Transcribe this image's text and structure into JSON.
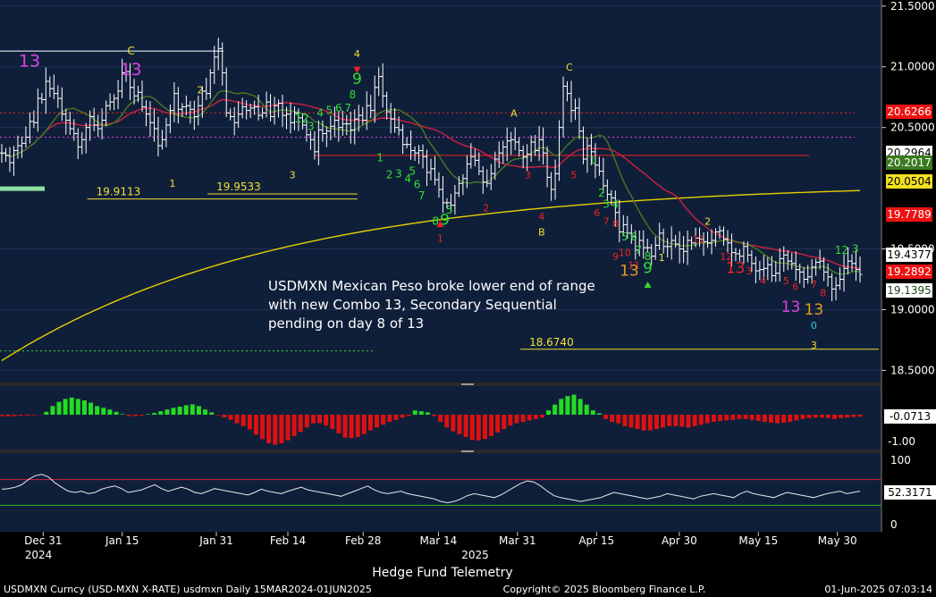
{
  "chart_data": {
    "type": "ohlc-bar",
    "instrument": "USDMXN",
    "colors": {
      "panel_bg": "#0f1f3a",
      "gap_bg": "#2a2a2a",
      "frame": "#7a7a7a",
      "bars": "#ffffff",
      "ma_yellow": "#e6d000",
      "ma_red": "#d02040",
      "ma_green": "#4a7a20",
      "td_green": "#33dd33",
      "td_yellow": "#f0e030",
      "td_red": "#ee2222",
      "td_magenta": "#e040e0",
      "td_orange": "#e89a1a",
      "hist_pos": "#22dd22",
      "hist_neg": "#dd1111",
      "rsi_line": "#e8e8e8"
    },
    "price_axis": {
      "min": 18.4,
      "max": 21.55,
      "ticks": [
        "21.5000",
        "21.0000",
        "20.5000",
        "19.5000",
        "19.0000",
        "18.5000"
      ],
      "tick_values": [
        21.5,
        21.0,
        20.5,
        19.5,
        19.0,
        18.5
      ]
    },
    "price_badges": [
      {
        "label": "20.6266",
        "value": 20.6266,
        "bg": "#ee1111",
        "fg": "#ffffff"
      },
      {
        "label": "20.2964",
        "value": 20.2964,
        "bg": "#ffffff",
        "fg": "#000000"
      },
      {
        "label": "20.2017",
        "value": 20.2017,
        "bg": "#3a7a20",
        "fg": "#ffffff"
      },
      {
        "label": "20.0504",
        "value": 20.0504,
        "bg": "#f0e020",
        "fg": "#000000"
      },
      {
        "label": "19.7789",
        "value": 19.7789,
        "bg": "#ee1111",
        "fg": "#ffffff"
      },
      {
        "label": "19.4377",
        "value": 19.4377,
        "bg": "#ffffff",
        "fg": "#000000"
      },
      {
        "label": "19.2892",
        "value": 19.2892,
        "bg": "#ee1111",
        "fg": "#ffffff"
      },
      {
        "label": "19.1395",
        "value": 19.1395,
        "bg": "#ffffff",
        "fg": "#1a4a1a"
      }
    ],
    "levels": [
      {
        "label": "19.9113",
        "value": 19.9113,
        "from": 28,
        "to": 82,
        "color": "#f0e030"
      },
      {
        "label": "19.9533",
        "value": 19.9533,
        "from": 58,
        "to": 82,
        "color": "#f0e030"
      },
      {
        "label": "18.6740",
        "value": 18.674,
        "from": 136,
        "to": 212,
        "color": "#f0e030"
      }
    ],
    "x_axis": {
      "labels": [
        {
          "text": "Dec 31",
          "i": 11
        },
        {
          "text": "Jan 15",
          "i": 32
        },
        {
          "text": "Jan 31",
          "i": 57
        },
        {
          "text": "Feb 14",
          "i": 76
        },
        {
          "text": "Feb 28",
          "i": 96
        },
        {
          "text": "Mar 14",
          "i": 116
        },
        {
          "text": "Mar 31",
          "i": 137
        },
        {
          "text": "Apr 15",
          "i": 158
        },
        {
          "text": "Apr 30",
          "i": 180
        },
        {
          "text": "May 15",
          "i": 201
        },
        {
          "text": "May 30",
          "i": 222
        }
      ],
      "years": [
        {
          "text": "2024",
          "i": 5
        },
        {
          "text": "2025",
          "i": 121
        }
      ]
    },
    "series": [
      {
        "name": "USDMXN",
        "close": [
          20.29,
          20.27,
          20.21,
          20.31,
          20.35,
          20.37,
          20.42,
          20.55,
          20.54,
          20.74,
          20.73,
          20.88,
          20.82,
          20.78,
          20.74,
          20.61,
          20.56,
          20.49,
          20.45,
          20.34,
          20.4,
          20.5,
          20.59,
          20.52,
          20.49,
          20.56,
          20.68,
          20.71,
          20.74,
          20.8,
          20.95,
          20.96,
          20.83,
          20.76,
          20.79,
          20.67,
          20.61,
          20.54,
          20.49,
          20.35,
          20.4,
          20.52,
          20.64,
          20.78,
          20.65,
          20.67,
          20.68,
          20.65,
          20.59,
          20.68,
          20.8,
          20.78,
          20.95,
          21.08,
          21.15,
          20.95,
          20.62,
          20.59,
          20.54,
          20.61,
          20.67,
          20.64,
          20.66,
          20.67,
          20.6,
          20.62,
          20.71,
          20.59,
          20.68,
          20.7,
          20.6,
          20.61,
          20.54,
          20.62,
          20.58,
          20.52,
          20.44,
          20.4,
          20.3,
          20.48,
          20.45,
          20.47,
          20.51,
          20.56,
          20.5,
          20.53,
          20.53,
          20.48,
          20.57,
          20.6,
          20.56,
          20.68,
          20.64,
          20.83,
          20.92,
          20.76,
          20.63,
          20.57,
          20.5,
          20.48,
          20.36,
          20.36,
          20.31,
          20.29,
          20.31,
          20.26,
          20.13,
          20.16,
          20.07,
          19.99,
          19.88,
          19.88,
          19.86,
          19.96,
          20.04,
          20.08,
          20.2,
          20.26,
          20.23,
          20.14,
          20.05,
          20.04,
          20.12,
          20.24,
          20.29,
          20.34,
          20.39,
          20.4,
          20.38,
          20.31,
          20.26,
          20.28,
          20.38,
          20.31,
          20.4,
          20.29,
          20.09,
          19.99,
          20.12,
          20.5,
          20.84,
          20.78,
          20.64,
          20.66,
          20.47,
          20.24,
          20.35,
          20.3,
          20.19,
          20.14,
          20.02,
          19.95,
          19.92,
          19.8,
          19.64,
          19.7,
          19.63,
          19.6,
          19.49,
          19.57,
          19.51,
          19.51,
          19.44,
          19.53,
          19.63,
          19.52,
          19.52,
          19.57,
          19.54,
          19.5,
          19.48,
          19.57,
          19.55,
          19.59,
          19.58,
          19.56,
          19.55,
          19.57,
          19.64,
          19.65,
          19.58,
          19.55,
          19.47,
          19.46,
          19.44,
          19.52,
          19.45,
          19.38,
          19.32,
          19.33,
          19.34,
          19.37,
          19.28,
          19.3,
          19.42,
          19.45,
          19.4,
          19.38,
          19.33,
          19.31,
          19.25,
          19.27,
          19.35,
          19.39,
          19.4,
          19.31,
          19.27,
          19.17,
          19.2,
          19.25,
          19.34,
          19.4,
          19.38,
          19.33,
          19.29
        ]
      },
      {
        "name": "MA-yellow-long"
      },
      {
        "name": "MA-red"
      },
      {
        "name": "MA-green"
      }
    ],
    "td_labels": [
      {
        "t": "13",
        "i": 6,
        "v": 21.0,
        "c": "td_magenta",
        "s": 19
      },
      {
        "t": "C",
        "i": 28,
        "v": 21.1,
        "c": "td_yellow",
        "s": 12
      },
      {
        "t": "13",
        "i": 28,
        "v": 20.93,
        "c": "td_magenta",
        "s": 19
      },
      {
        "t": "1",
        "i": 37,
        "v": 20.01,
        "c": "td_yellow",
        "s": 11
      },
      {
        "t": "2",
        "i": 43,
        "v": 20.78,
        "c": "td_yellow",
        "s": 11
      },
      {
        "t": "12",
        "i": 65,
        "v": 20.54,
        "c": "td_green",
        "s": 13
      },
      {
        "t": "3",
        "i": 67,
        "v": 20.48,
        "c": "td_green",
        "s": 12
      },
      {
        "t": "4",
        "i": 69,
        "v": 20.59,
        "c": "td_green",
        "s": 12
      },
      {
        "t": "5",
        "i": 71,
        "v": 20.61,
        "c": "td_green",
        "s": 12
      },
      {
        "t": "6",
        "i": 73,
        "v": 20.63,
        "c": "td_green",
        "s": 12
      },
      {
        "t": "7",
        "i": 75,
        "v": 20.63,
        "c": "td_green",
        "s": 12
      },
      {
        "t": "8",
        "i": 76,
        "v": 20.74,
        "c": "td_green",
        "s": 12
      },
      {
        "t": "9",
        "i": 77,
        "v": 20.86,
        "c": "td_green",
        "s": 17
      },
      {
        "t": "4",
        "i": 77,
        "v": 21.08,
        "c": "td_yellow",
        "s": 11
      },
      {
        "t": "3",
        "i": 63,
        "v": 20.08,
        "c": "td_yellow",
        "s": 11
      },
      {
        "t": "1",
        "i": 82,
        "v": 20.22,
        "c": "td_green",
        "s": 12
      },
      {
        "t": "2",
        "i": 84,
        "v": 20.08,
        "c": "td_green",
        "s": 12
      },
      {
        "t": "3",
        "i": 86,
        "v": 20.09,
        "c": "td_green",
        "s": 12
      },
      {
        "t": "4",
        "i": 88,
        "v": 20.05,
        "c": "td_green",
        "s": 12
      },
      {
        "t": "5",
        "i": 89,
        "v": 20.11,
        "c": "td_green",
        "s": 12
      },
      {
        "t": "6",
        "i": 90,
        "v": 20.0,
        "c": "td_green",
        "s": 12
      },
      {
        "t": "7",
        "i": 91,
        "v": 19.91,
        "c": "td_green",
        "s": 12
      },
      {
        "t": "5",
        "i": 97,
        "v": 19.79,
        "c": "td_green",
        "s": 12
      },
      {
        "t": "8",
        "i": 94,
        "v": 19.7,
        "c": "td_green",
        "s": 12
      },
      {
        "t": "9",
        "i": 96,
        "v": 19.7,
        "c": "td_green",
        "s": 17
      },
      {
        "t": "1",
        "i": 95,
        "v": 19.56,
        "c": "td_red",
        "s": 11
      },
      {
        "t": "2",
        "i": 105,
        "v": 19.81,
        "c": "td_red",
        "s": 11
      },
      {
        "t": "A",
        "i": 111,
        "v": 20.59,
        "c": "td_yellow",
        "s": 11
      },
      {
        "t": "3",
        "i": 114,
        "v": 20.08,
        "c": "td_red",
        "s": 11
      },
      {
        "t": "4",
        "i": 117,
        "v": 19.74,
        "c": "td_red",
        "s": 11
      },
      {
        "t": "B",
        "i": 117,
        "v": 19.61,
        "c": "td_yellow",
        "s": 11
      },
      {
        "t": "5",
        "i": 124,
        "v": 20.08,
        "c": "td_red",
        "s": 11
      },
      {
        "t": "C",
        "i": 123,
        "v": 20.97,
        "c": "td_yellow",
        "s": 11
      },
      {
        "t": "1",
        "i": 128,
        "v": 20.2,
        "c": "td_green",
        "s": 12
      },
      {
        "t": "2",
        "i": 130,
        "v": 19.93,
        "c": "td_green",
        "s": 12
      },
      {
        "t": "3",
        "i": 131,
        "v": 19.84,
        "c": "td_green",
        "s": 12
      },
      {
        "t": "4",
        "i": 133,
        "v": 19.84,
        "c": "td_green",
        "s": 12
      },
      {
        "t": "6",
        "i": 129,
        "v": 19.77,
        "c": "td_red",
        "s": 11
      },
      {
        "t": "7",
        "i": 131,
        "v": 19.7,
        "c": "td_red",
        "s": 11
      },
      {
        "t": "8",
        "i": 133,
        "v": 19.68,
        "c": "td_red",
        "s": 11
      },
      {
        "t": "5",
        "i": 135,
        "v": 19.57,
        "c": "td_green",
        "s": 12
      },
      {
        "t": "6",
        "i": 137,
        "v": 19.57,
        "c": "td_green",
        "s": 12
      },
      {
        "t": "7",
        "i": 138,
        "v": 19.46,
        "c": "td_green",
        "s": 12
      },
      {
        "t": "8",
        "i": 140,
        "v": 19.41,
        "c": "td_green",
        "s": 12
      },
      {
        "t": "9",
        "i": 133,
        "v": 19.41,
        "c": "td_red",
        "s": 11
      },
      {
        "t": "10",
        "i": 135,
        "v": 19.44,
        "c": "td_red",
        "s": 11
      },
      {
        "t": "11",
        "i": 137,
        "v": 19.34,
        "c": "td_red",
        "s": 11
      },
      {
        "t": "13",
        "i": 136,
        "v": 19.28,
        "c": "td_orange",
        "s": 17
      },
      {
        "t": "9",
        "i": 140,
        "v": 19.3,
        "c": "td_green",
        "s": 17
      },
      {
        "t": "1",
        "i": 143,
        "v": 19.4,
        "c": "td_yellow",
        "s": 11
      },
      {
        "t": "2",
        "i": 153,
        "v": 19.7,
        "c": "td_yellow",
        "s": 11
      },
      {
        "t": "11",
        "i": 151,
        "v": 19.55,
        "c": "td_red",
        "s": 11
      },
      {
        "t": "12",
        "i": 157,
        "v": 19.41,
        "c": "td_red",
        "s": 11
      },
      {
        "t": "13",
        "i": 159,
        "v": 19.3,
        "c": "td_red",
        "s": 17
      },
      {
        "t": "3",
        "i": 162,
        "v": 19.29,
        "c": "td_red",
        "s": 11
      },
      {
        "t": "4",
        "i": 165,
        "v": 19.21,
        "c": "td_red",
        "s": 11
      },
      {
        "t": "5",
        "i": 170,
        "v": 19.21,
        "c": "td_red",
        "s": 11
      },
      {
        "t": "6",
        "i": 172,
        "v": 19.16,
        "c": "td_red",
        "s": 11
      },
      {
        "t": "7",
        "i": 176,
        "v": 19.18,
        "c": "td_red",
        "s": 11
      },
      {
        "t": "8",
        "i": 178,
        "v": 19.11,
        "c": "td_red",
        "s": 11
      },
      {
        "t": "13",
        "i": 171,
        "v": 18.98,
        "c": "td_magenta",
        "s": 17
      },
      {
        "t": "13",
        "i": 176,
        "v": 18.96,
        "c": "td_orange",
        "s": 17
      },
      {
        "t": "0",
        "i": 176,
        "v": 18.84,
        "c": "td_cyan",
        "s": 11
      },
      {
        "t": "3",
        "i": 176,
        "v": 18.68,
        "c": "td_yellow",
        "s": 11
      },
      {
        "t": "12",
        "i": 182,
        "v": 19.46,
        "c": "td_green",
        "s": 12
      },
      {
        "t": "3",
        "i": 185,
        "v": 19.47,
        "c": "td_green",
        "s": 12
      }
    ],
    "annotation": [
      "USDMXN Mexican Peso broke lower end of range",
      "with new Combo 13, Secondary Sequential",
      "pending on day 8 of 13"
    ],
    "macd": {
      "axis_labels": [
        "-0.0713",
        "-1.00"
      ],
      "values": [
        -0.05,
        -0.06,
        -0.05,
        -0.04,
        -0.03,
        -0.02,
        -0.01,
        0.1,
        0.3,
        0.45,
        0.55,
        0.6,
        0.55,
        0.5,
        0.42,
        0.3,
        0.24,
        0.18,
        0.1,
        0.02,
        -0.05,
        -0.05,
        -0.03,
        0.02,
        0.06,
        0.12,
        0.18,
        0.24,
        0.28,
        0.33,
        0.36,
        0.3,
        0.18,
        0.08,
        -0.02,
        -0.1,
        -0.18,
        -0.3,
        -0.4,
        -0.52,
        -0.7,
        -0.85,
        -1.0,
        -1.05,
        -1.0,
        -0.9,
        -0.75,
        -0.6,
        -0.45,
        -0.3,
        -0.3,
        -0.38,
        -0.5,
        -0.65,
        -0.8,
        -0.82,
        -0.78,
        -0.68,
        -0.55,
        -0.45,
        -0.35,
        -0.25,
        -0.18,
        -0.1,
        -0.05,
        0.15,
        0.12,
        0.08,
        -0.05,
        -0.25,
        -0.45,
        -0.58,
        -0.68,
        -0.78,
        -0.88,
        -0.9,
        -0.85,
        -0.75,
        -0.62,
        -0.5,
        -0.38,
        -0.3,
        -0.25,
        -0.2,
        -0.15,
        -0.1,
        0.15,
        0.35,
        0.55,
        0.65,
        0.7,
        0.55,
        0.35,
        0.15,
        0.05,
        -0.15,
        -0.25,
        -0.3,
        -0.4,
        -0.45,
        -0.5,
        -0.55,
        -0.55,
        -0.5,
        -0.45,
        -0.4,
        -0.4,
        -0.42,
        -0.45,
        -0.4,
        -0.35,
        -0.3,
        -0.25,
        -0.22,
        -0.2,
        -0.18,
        -0.15,
        -0.15,
        -0.18,
        -0.22,
        -0.25,
        -0.28,
        -0.3,
        -0.28,
        -0.25,
        -0.2,
        -0.15,
        -0.12,
        -0.1,
        -0.1,
        -0.12,
        -0.15,
        -0.12,
        -0.1,
        -0.08,
        -0.07
      ]
    },
    "rsi": {
      "axis_labels": [
        "100",
        "52.3171",
        "0"
      ],
      "upper": 70,
      "lower": 30,
      "values": [
        55,
        56,
        58,
        62,
        70,
        76,
        78,
        74,
        65,
        58,
        52,
        50,
        52,
        48,
        50,
        55,
        58,
        60,
        56,
        50,
        52,
        54,
        58,
        62,
        56,
        52,
        55,
        58,
        55,
        50,
        48,
        52,
        56,
        54,
        52,
        50,
        48,
        46,
        50,
        55,
        52,
        50,
        48,
        52,
        55,
        58,
        54,
        52,
        50,
        48,
        46,
        44,
        48,
        52,
        56,
        60,
        54,
        50,
        48,
        50,
        52,
        48,
        46,
        44,
        42,
        40,
        36,
        34,
        36,
        40,
        45,
        48,
        46,
        44,
        42,
        46,
        52,
        58,
        64,
        68,
        66,
        60,
        52,
        45,
        42,
        40,
        38,
        36,
        38,
        40,
        42,
        46,
        50,
        48,
        46,
        44,
        42,
        40,
        42,
        44,
        48,
        46,
        44,
        42,
        40,
        44,
        46,
        48,
        46,
        44,
        42,
        48,
        52,
        48,
        46,
        44,
        42,
        46,
        50,
        48,
        46,
        44,
        42,
        45,
        48,
        50,
        52,
        48,
        50,
        52
      ]
    },
    "footer": {
      "series_title": "Hedge Fund Telemetry",
      "left": "USDMXN Curncy (USD-MXN X-RATE) usdmxn  Daily 15MAR2024-01JUN2025",
      "center": "Copyright© 2025 Bloomberg Finance L.P.",
      "right": "01-Jun-2025 07:03:14"
    }
  }
}
